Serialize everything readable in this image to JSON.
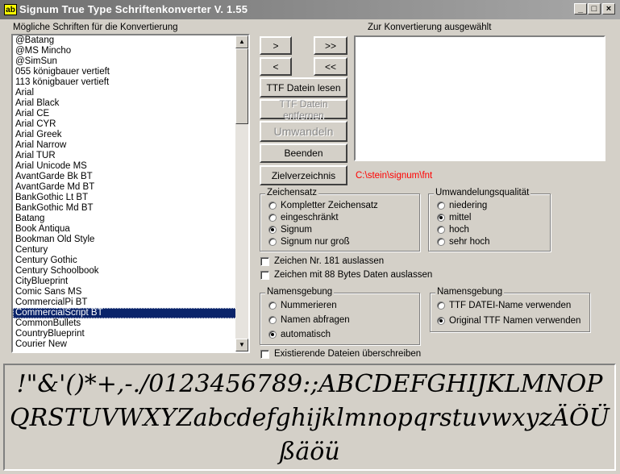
{
  "window": {
    "app_icon": "ab",
    "title": "Signum True Type Schriftenkonverter V. 1.55",
    "minimize_label": "_",
    "maximize_label": "□",
    "close_label": "×"
  },
  "left_label": "Mögliche Schriften für die Konvertierung",
  "right_label": "Zur Konvertierung ausgewählt",
  "fonts": [
    "@Batang",
    "@MS Mincho",
    "@SimSun",
    "055 königbauer vertieft",
    "113 königbauer vertieft",
    "Arial",
    "Arial Black",
    "Arial CE",
    "Arial CYR",
    "Arial Greek",
    "Arial Narrow",
    "Arial TUR",
    "Arial Unicode MS",
    "AvantGarde Bk BT",
    "AvantGarde Md BT",
    "BankGothic Lt BT",
    "BankGothic Md BT",
    "Batang",
    "Book Antiqua",
    "Bookman Old Style",
    "Century",
    "Century Gothic",
    "Century Schoolbook",
    "CityBlueprint",
    "Comic Sans MS",
    "CommercialPi BT",
    "CommercialScript BT",
    "CommonBullets",
    "CountryBlueprint",
    "Courier New"
  ],
  "selected_font_index": 26,
  "buttons": {
    "add_one": ">",
    "add_all": ">>",
    "remove_one": "<",
    "remove_all": "<<",
    "read_ttf": "TTF Datein lesen",
    "remove_ttf": "TTF Datein entfernen",
    "convert": "Umwandeln",
    "quit": "Beenden",
    "target_dir": "Zielverzeichnis"
  },
  "target_path": "C:\\stein\\signum\\fnt",
  "charset": {
    "legend": "Zeichensatz",
    "options": [
      "Kompletter Zeichensatz",
      "eingeschränkt",
      "Signum",
      "Signum nur groß"
    ],
    "selected": 2
  },
  "quality": {
    "legend": "Umwandelungsqualität",
    "options": [
      "niedering",
      "mittel",
      "hoch",
      "sehr hoch"
    ],
    "selected": 1
  },
  "checks": {
    "skip_181": "Zeichen Nr. 181 auslassen",
    "skip_88": "Zeichen mit 88 Bytes Daten auslassen",
    "overwrite": "Existierende Dateien überschreiben"
  },
  "naming_left": {
    "legend": "Namensgebung",
    "options": [
      "Nummerieren",
      "Namen abfragen",
      "automatisch"
    ],
    "selected": 2
  },
  "naming_right": {
    "legend": "Namensgebung",
    "options": [
      "TTF DATEI-Name verwenden",
      "Original TTF Namen verwenden"
    ],
    "selected": 1
  },
  "preview_lines": [
    "!\"&'()*+,-./0123456789:;ABCDEFGHIJKLMNOP",
    "QRSTUVWXYZabcdefghijklmnopqrstuvwxyzÄÖÜ",
    "ßäöü"
  ],
  "colors": {
    "face": "#d4d0c8",
    "selection": "#0a246a",
    "path_text": "#ff0000"
  }
}
